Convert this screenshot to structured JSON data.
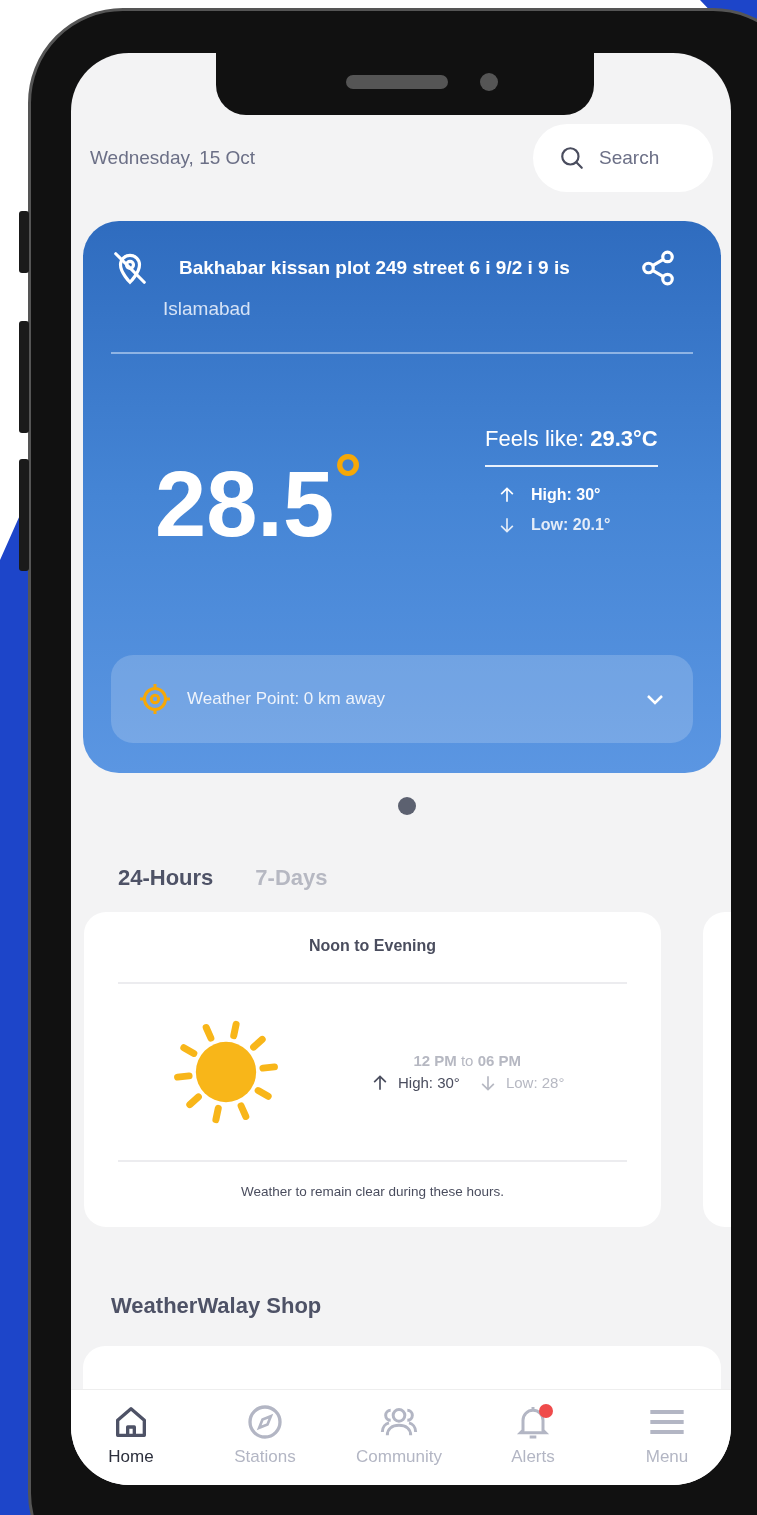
{
  "header": {
    "date": "Wednesday, 15 Oct",
    "search": {
      "placeholder": "Search"
    }
  },
  "location_card": {
    "address": "Bakhabar kissan plot 249 street 6 i 9/2 i 9 is",
    "city": "Islamabad",
    "temperature": "28.5",
    "unit": "°",
    "feels_like": "Feels like: **29.3°C**",
    "high": "High: 30°",
    "low": "Low: 20.1°",
    "weather_point": "Weather Point: 0 km away"
  },
  "pager": [
    {
      "selected": true
    }
  ],
  "tabs": [
    {
      "label": "24-Hours",
      "selected": true
    },
    {
      "label": "7-Days",
      "selected": false
    }
  ],
  "forecast_cards": [
    {
      "title": "Noon to Evening",
      "time_range": "**12 PM** to **06 PM**",
      "high": "High: 30°",
      "low": "Low: 28°",
      "note": "Weather to remain clear during these hours."
    }
  ],
  "shop": {
    "title": "WeatherWalay Shop"
  },
  "bottom_nav": [
    {
      "label": "Home",
      "kind": "home",
      "selected": true,
      "alert": false
    },
    {
      "label": "Stations",
      "kind": "compass",
      "selected": false,
      "alert": false
    },
    {
      "label": "Community",
      "kind": "people",
      "selected": false,
      "alert": false
    },
    {
      "label": "Alerts",
      "kind": "bell",
      "selected": false,
      "alert": true
    },
    {
      "label": "Menu",
      "kind": "menu",
      "selected": false,
      "alert": false
    }
  ]
}
